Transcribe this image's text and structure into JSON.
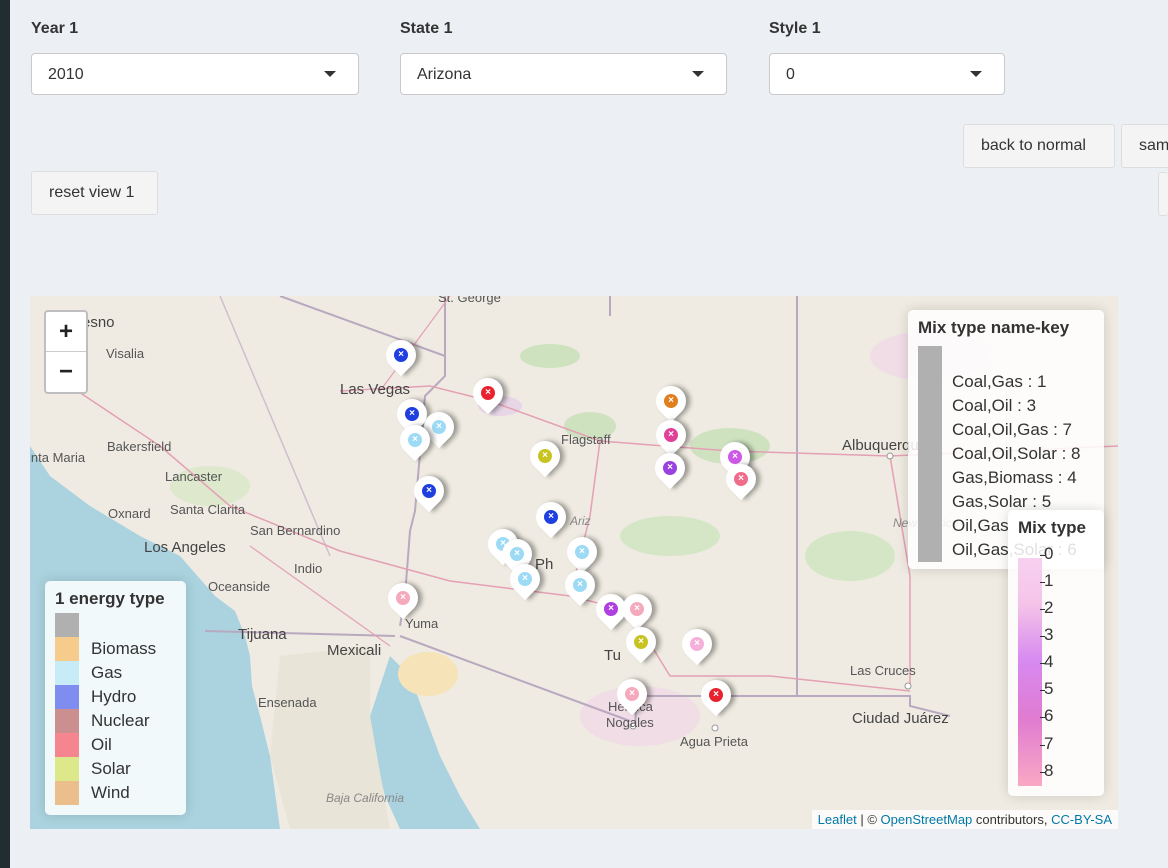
{
  "controls": {
    "year": {
      "label": "Year 1",
      "value": "2010"
    },
    "state": {
      "label": "State 1",
      "value": "Arizona"
    },
    "style": {
      "label": "Style 1",
      "value": "0"
    }
  },
  "buttons": {
    "back_to_normal": "back to normal",
    "same_partial": "sam",
    "reset_view": "reset view 1"
  },
  "map": {
    "zoom_in": "+",
    "zoom_out": "−",
    "places": {
      "st_george": "St. George",
      "fresno": "esno",
      "visalia": "Visalia",
      "las_vegas": "Las Vegas",
      "bakersfield": "Bakersfield",
      "santa_maria": "inta Maria",
      "lancaster": "Lancaster",
      "oxnard": "Oxnard",
      "santa_clarita": "Santa Clarita",
      "san_bernardino": "San Bernardino",
      "los_angeles": "Los Angeles",
      "indio": "Indio",
      "oceanside": "Oceanside",
      "tijuana": "Tijuana",
      "mexicali": "Mexicali",
      "ensenada": "Ensenada",
      "baja_california": "Baja California",
      "flagstaff": "Flagstaff",
      "albuquerque": "Albuquerque",
      "new_mexico": "New Mexico",
      "las_cruces": "Las Cruces",
      "ciudad_juarez": "Ciudad Juárez",
      "agua_prieta": "Agua Prieta",
      "nogales": "Nogales",
      "heroica": "Heroica",
      "yuma": "Yuma",
      "tucson": "Tu",
      "phoenix": "Ph",
      "arizona": "Ariz"
    },
    "attribution": {
      "leaflet": "Leaflet",
      "sep": " | © ",
      "osm": "OpenStreetMap",
      "contrib": " contributors, ",
      "license": "CC-BY-SA"
    }
  },
  "legend_energy": {
    "title": "1 energy type",
    "items": [
      {
        "label": "",
        "color": "#b0b0b0"
      },
      {
        "label": "Biomass",
        "color": "#f6cc8c"
      },
      {
        "label": "Gas",
        "color": "#c7ecf7"
      },
      {
        "label": "Hydro",
        "color": "#7f8cf0"
      },
      {
        "label": "Nuclear",
        "color": "#cc8f8f"
      },
      {
        "label": "Oil",
        "color": "#f5858f"
      },
      {
        "label": "Solar",
        "color": "#dde88a"
      },
      {
        "label": "Wind",
        "color": "#ebbf8c"
      }
    ]
  },
  "legend_key": {
    "title": "Mix type name-key",
    "items": [
      "Coal,Gas : 1",
      "Coal,Oil : 3",
      "Coal,Oil,Gas : 7",
      "Coal,Oil,Solar : 8",
      "Gas,Biomass : 4",
      "Gas,Solar : 5",
      "Oil,Gas",
      "Oil,Gas,Solar : 6"
    ]
  },
  "legend_mix": {
    "title": "Mix type",
    "ticks": [
      "0",
      "1",
      "2",
      "3",
      "4",
      "5",
      "6",
      "7",
      "8"
    ]
  },
  "markers": [
    {
      "color": "#1f3fe0",
      "icon": "x-icon"
    },
    {
      "color": "#e8232f",
      "icon": "x-icon"
    },
    {
      "color": "#e07f1f",
      "icon": "x-icon"
    },
    {
      "color": "#e0409a",
      "icon": "x-icon"
    },
    {
      "color": "#9a3fe0",
      "icon": "x-icon"
    },
    {
      "color": "#ce58e8",
      "icon": "x-icon"
    },
    {
      "color": "#ef6d8a",
      "icon": "x-icon"
    },
    {
      "color": "#1f3fe0",
      "icon": "x-icon"
    },
    {
      "color": "#9ddaf5",
      "icon": "x-icon"
    },
    {
      "color": "#9ddaf5",
      "icon": "x-icon"
    },
    {
      "color": "#c7c421",
      "icon": "x-icon"
    },
    {
      "color": "#1f3fe0",
      "icon": "x-icon"
    },
    {
      "color": "#1f3fe0",
      "icon": "x-icon"
    },
    {
      "color": "#9ddaf5",
      "icon": "x-icon"
    },
    {
      "color": "#9ddaf5",
      "icon": "x-icon"
    },
    {
      "color": "#9ddaf5",
      "icon": "x-icon"
    },
    {
      "color": "#9ddaf5",
      "icon": "x-icon"
    },
    {
      "color": "#9ddaf5",
      "icon": "x-icon"
    },
    {
      "color": "#f5a9bd",
      "icon": "x-icon"
    },
    {
      "color": "#b03fe0",
      "icon": "x-icon"
    },
    {
      "color": "#f5a9bd",
      "icon": "x-icon"
    },
    {
      "color": "#c7c421",
      "icon": "x-icon"
    },
    {
      "color": "#f5b0d9",
      "icon": "x-icon"
    },
    {
      "color": "#f5a9bd",
      "icon": "x-icon"
    },
    {
      "color": "#e8232f",
      "icon": "x-icon"
    }
  ]
}
